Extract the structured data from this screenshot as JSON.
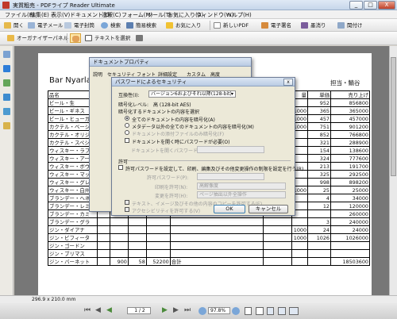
{
  "window": {
    "title": "実質粗売 - PDFライプ Reader Ultimate",
    "min": "_",
    "max": "□",
    "close": "X"
  },
  "menu": [
    "ファイル(F)",
    "編集(E)",
    "表示(V)",
    "ドキュメント(D)",
    "注釈(C)",
    "フォーム(M)",
    "ツール(T)",
    "お気に入り(A)",
    "ウィンドウ(W)",
    "ヘルプ(H)"
  ],
  "toolbar1": {
    "open": "開く",
    "email": "電子メール",
    "print": "電子封筒",
    "search": "検索",
    "advsearch": "簡易検索",
    "favorites": "お気に入り",
    "newpdf": "新しいPDF",
    "sign": "電子署名",
    "stamp": "墨消り",
    "properties": "関付け"
  },
  "toolbar2": {
    "organizer": "オーガナイザーパネル",
    "select_text": "テキストを選択"
  },
  "document": {
    "title": "Bar Nyarlat",
    "right_header": "担当・鯖谷",
    "headers": [
      "品名",
      "",
      "",
      "",
      "",
      "",
      "",
      "量",
      "単価",
      "売り上げ"
    ],
    "rows": [
      [
        "ビール・生",
        "",
        "",
        "",
        "",
        "",
        "",
        "",
        "952",
        "856800"
      ],
      [
        "ビール・ギネス",
        "",
        "",
        "",
        "",
        "",
        "",
        "1000",
        "365",
        "365000"
      ],
      [
        "ビール・ヒューガ",
        "",
        "",
        "",
        "",
        "",
        "",
        "1000",
        "457",
        "457000"
      ],
      [
        "カクテル・ベーシ",
        "",
        "",
        "",
        "",
        "",
        "",
        "1000",
        "751",
        "901200"
      ],
      [
        "カクテル・オリジ",
        "",
        "",
        "",
        "",
        "",
        "",
        "",
        "852",
        "766800"
      ],
      [
        "カクテル・スペシ",
        "",
        "",
        "",
        "",
        "",
        "",
        "",
        "321",
        "288900"
      ],
      [
        "ウィスキー・ラフロ",
        "",
        "",
        "",
        "",
        "",
        "",
        "",
        "154",
        "138600"
      ],
      [
        "ウィスキー・アー",
        "",
        "",
        "",
        "",
        "",
        "",
        "",
        "324",
        "777600"
      ],
      [
        "ウィスキー・ボウ",
        "",
        "",
        "",
        "",
        "",
        "",
        "",
        "213",
        "191700"
      ],
      [
        "ウィスキー・マッ",
        "",
        "",
        "",
        "",
        "",
        "",
        "",
        "325",
        "292500"
      ],
      [
        "ウィスキー・グレ",
        "",
        "",
        "",
        "",
        "",
        "",
        "",
        "998",
        "898200"
      ],
      [
        "ウィスキー・白州",
        "",
        "",
        "",
        "",
        "",
        "",
        "1000",
        "25",
        "25000"
      ],
      [
        "ブランデー・ヘネ",
        "",
        "",
        "",
        "",
        "",
        "",
        "",
        "4",
        "34000"
      ],
      [
        "ブランデー・レミ",
        "",
        "",
        "",
        "",
        "",
        "",
        "",
        "12",
        "120000"
      ],
      [
        "ブランデー・カミ",
        "",
        "",
        "",
        "",
        "",
        "",
        "",
        "",
        "260000"
      ],
      [
        "ブランデー・グラ",
        "",
        "",
        "",
        "",
        "",
        "",
        "",
        "3",
        "240000"
      ],
      [
        "ジン・ダイアナ",
        "",
        "",
        "",
        "",
        "",
        "",
        "1000",
        "24",
        "24000"
      ],
      [
        "ジン・ビフィータ",
        "",
        "",
        "",
        "",
        "",
        "",
        "1000",
        "1026",
        "1026000"
      ],
      [
        "ジン・ゴードン",
        "",
        "",
        "",
        "",
        "",
        "",
        "",
        "",
        ""
      ],
      [
        "ジン・ブリマス",
        "",
        "",
        "",
        "",
        "",
        "",
        "",
        "",
        ""
      ],
      [
        "ジン・バーネット",
        "",
        "900",
        "58",
        "52200",
        "合計",
        "",
        "",
        "",
        "18503600"
      ]
    ]
  },
  "status": {
    "size": "296.9 x 210.0 mm"
  },
  "nav": {
    "page": "1 / 2",
    "zoom": "97.8%"
  },
  "props_dialog": {
    "title": "ドキュメントプロパティ",
    "tabs": [
      "説明",
      "セキュリティ",
      "フォント",
      "詳細設定",
      "カスタム",
      "高度"
    ]
  },
  "security_dialog": {
    "title": "パスワードによるセキュリティ",
    "compat_label": "互換性(I):",
    "compat_value": "バージョン6およびそれ以降(128-bit)",
    "enc_level_label": "暗号化レベル:",
    "enc_level_value": "高 (128-bit AES)",
    "enc_target_label": "暗号化するドキュメントの内容を選択",
    "opt_all": "全てのドキュメントの内容を暗号化(A)",
    "opt_except_meta": "メタデータ以外の全てのドキュメントの内容を暗号化(M)",
    "opt_attach": "ドキュメントの添付ファイルのみ暗号化(F)",
    "open_pw_check": "ドキュメントを開く時にパスワードが必要(O)",
    "open_pw_label": "ドキュメントを開くパスワード(S):",
    "perm_section": "許可",
    "perm_check": "許可パスワードを設定して、印刷、編集及びその他変更操作の制限を設定を行う(R)",
    "perm_pw_label": "許可パスワード(P):",
    "print_label": "印刷を許可(N):",
    "print_value": "高解像度",
    "change_label": "変更を許可(H):",
    "change_value": "ページ抽出以外全操作",
    "copy_check": "テキスト、イメージ及びその他の内容のコピーを許可する(E)",
    "access_check": "アクセシビリティを許可する(V)",
    "ok": "OK",
    "cancel": "キャンセル"
  }
}
